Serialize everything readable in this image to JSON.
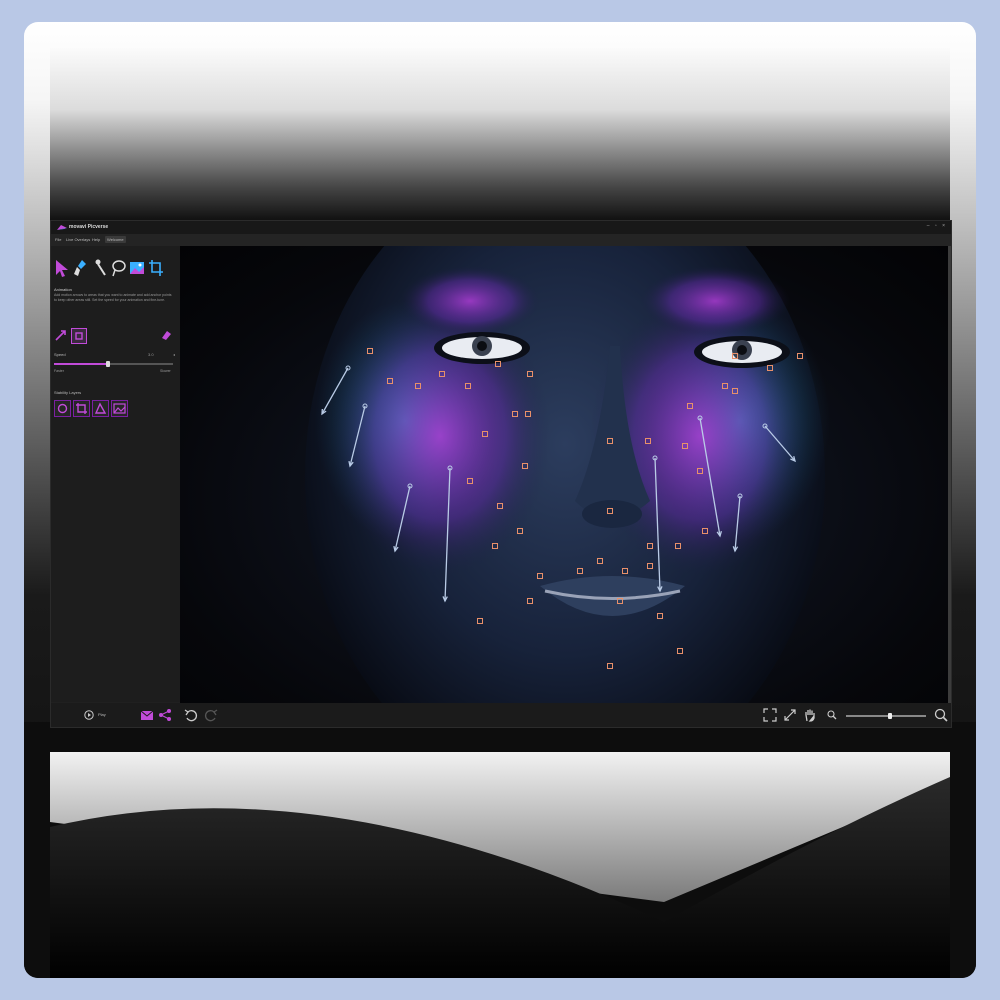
{
  "app": {
    "name": "movavi Picverse",
    "window_controls": "– ▫ ×",
    "menu": [
      {
        "label": "File"
      },
      {
        "label": "Live Overlays"
      },
      {
        "label": "Help"
      },
      {
        "label": "Welcome"
      }
    ]
  },
  "sidebar": {
    "tools": [
      {
        "icon": "motion-arrow-icon"
      },
      {
        "icon": "anchor-brush-icon"
      },
      {
        "icon": "pin-icon"
      },
      {
        "icon": "lasso-icon"
      },
      {
        "icon": "sky-icon"
      },
      {
        "icon": "crop-icon"
      }
    ],
    "section_title": "Animation",
    "description": "Add motion arrows to areas that you want to animate and add anchor points to keep other areas still. Set the speed for your animation and fine-tune.",
    "speed": {
      "label": "Speed",
      "value": "3.0",
      "min_label": "Faster",
      "max_label": "Slower",
      "level": 0.45
    },
    "layers_title": "Stability Layers"
  },
  "bottom": {
    "play_label": "Play",
    "zoom_level": 0.55
  },
  "colors": {
    "accent": "#c14bd9",
    "anchor": "#e8906a",
    "arrow": "#b9cbe6"
  }
}
